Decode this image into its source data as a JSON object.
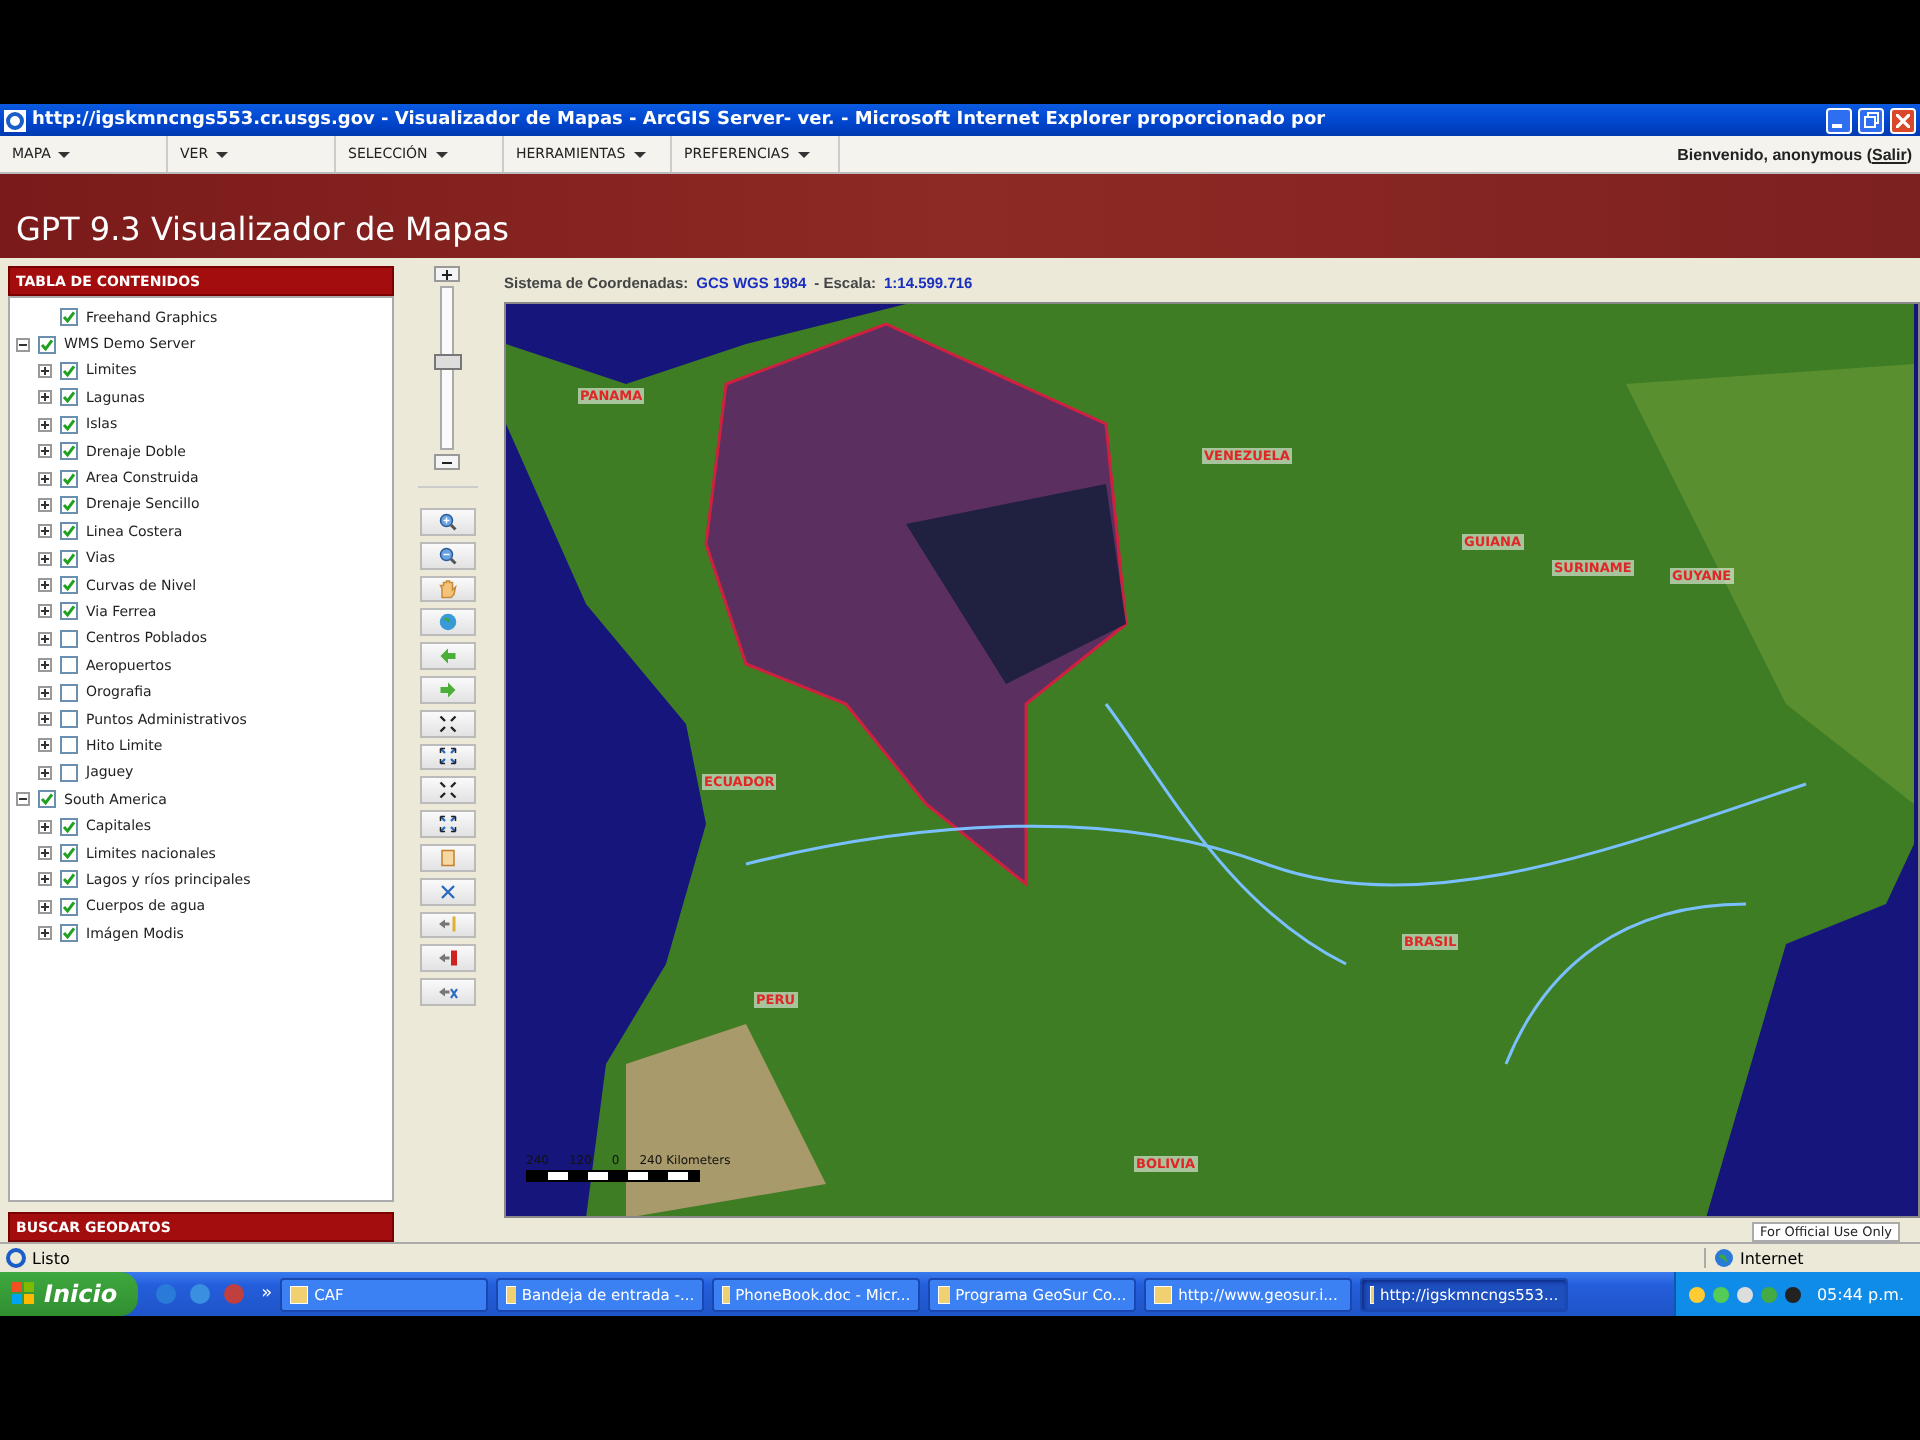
{
  "window": {
    "title": "http://igskmncngs553.cr.usgs.gov - Visualizador de Mapas - ArcGIS Server- ver. - Microsoft Internet Explorer proporcionado por"
  },
  "menu": [
    {
      "label": "MAPA"
    },
    {
      "label": "VER"
    },
    {
      "label": "SELECCIÓN"
    },
    {
      "label": "HERRAMIENTAS"
    },
    {
      "label": "PREFERENCIAS"
    }
  ],
  "welcome": {
    "before": "Bienvenido, anonymous (",
    "link": "Salir",
    "after": ")"
  },
  "banner": {
    "title": "GPT 9.3 Visualizador de Mapas"
  },
  "toc": {
    "title": "TABLA DE CONTENIDOS",
    "items": [
      {
        "label": "Freehand Graphics",
        "checked": true
      },
      {
        "label": "WMS Demo Server",
        "checked": true,
        "expanded": true,
        "children": [
          {
            "label": "Limites",
            "checked": true,
            "expanded": false
          },
          {
            "label": "Lagunas",
            "checked": true,
            "expanded": false
          },
          {
            "label": "Islas",
            "checked": true,
            "expanded": false
          },
          {
            "label": "Drenaje Doble",
            "checked": true,
            "expanded": false
          },
          {
            "label": "Area Construida",
            "checked": true,
            "expanded": false
          },
          {
            "label": "Drenaje Sencillo",
            "checked": true,
            "expanded": false
          },
          {
            "label": "Linea Costera",
            "checked": true,
            "expanded": false
          },
          {
            "label": "Vias",
            "checked": true,
            "expanded": false
          },
          {
            "label": "Curvas de Nivel",
            "checked": true,
            "expanded": false
          },
          {
            "label": "Via Ferrea",
            "checked": true,
            "expanded": false
          },
          {
            "label": "Centros Poblados",
            "checked": false,
            "expanded": false
          },
          {
            "label": "Aeropuertos",
            "checked": false,
            "expanded": false
          },
          {
            "label": "Orografia",
            "checked": false,
            "expanded": false
          },
          {
            "label": "Puntos Administrativos",
            "checked": false,
            "expanded": false
          },
          {
            "label": "Hito Limite",
            "checked": false,
            "expanded": false
          },
          {
            "label": "Jaguey",
            "checked": false,
            "expanded": false
          }
        ]
      },
      {
        "label": "South America",
        "checked": true,
        "expanded": true,
        "children": [
          {
            "label": "Capitales",
            "checked": true,
            "expanded": false
          },
          {
            "label": "Limites nacionales",
            "checked": true,
            "expanded": false
          },
          {
            "label": "Lagos y ríos principales",
            "checked": true,
            "expanded": false
          },
          {
            "label": "Cuerpos de agua",
            "checked": true,
            "expanded": false
          },
          {
            "label": "Imágen Modis",
            "checked": true,
            "expanded": false
          }
        ]
      }
    ]
  },
  "search_panel": {
    "title": "BUSCAR GEODATOS"
  },
  "zoom_slider": {
    "level": 0.55
  },
  "tools": [
    {
      "kind": "zoom-in"
    },
    {
      "kind": "zoom-out"
    },
    {
      "kind": "pan"
    },
    {
      "kind": "full-extent"
    },
    {
      "kind": "back"
    },
    {
      "kind": "forward"
    },
    {
      "kind": "shrink"
    },
    {
      "kind": "expand"
    },
    {
      "kind": "shrink"
    },
    {
      "kind": "expand"
    },
    {
      "kind": "identify"
    },
    {
      "kind": "measure"
    },
    {
      "kind": "arrow-yellow"
    },
    {
      "kind": "arrow-red"
    },
    {
      "kind": "arrow-measure"
    }
  ],
  "map": {
    "coord_label": "Sistema de Coordenadas:",
    "coord_value": "GCS WGS 1984",
    "scale_label": "- Escala:",
    "scale_value": "1:14.599.716",
    "labels": [
      {
        "text": "PANAMA"
      },
      {
        "text": "VENEZUELA"
      },
      {
        "text": "GUIANA"
      },
      {
        "text": "SURINAME"
      },
      {
        "text": "GUYANE"
      },
      {
        "text": "ECUADOR"
      },
      {
        "text": "BRASIL"
      },
      {
        "text": "PERU"
      },
      {
        "text": "BOLIVIA"
      }
    ],
    "scale_ticks": [
      "240",
      "120",
      "0",
      "240 Kilometers"
    ],
    "footer": "For Official Use Only"
  },
  "status_bar": {
    "text": "Listo",
    "zone": "Internet"
  },
  "taskbar": {
    "start": "Inicio",
    "more": "»",
    "tasks": [
      {
        "label": "CAF",
        "selected": false
      },
      {
        "label": "Bandeja de entrada -...",
        "selected": false
      },
      {
        "label": "PhoneBook.doc - Micr...",
        "selected": false
      },
      {
        "label": "Programa GeoSur Co...",
        "selected": false
      },
      {
        "label": "http://www.geosur.i...",
        "selected": false
      },
      {
        "label": "http://igskmncngs553...",
        "selected": true
      }
    ],
    "clock": "05:44 p.m."
  }
}
